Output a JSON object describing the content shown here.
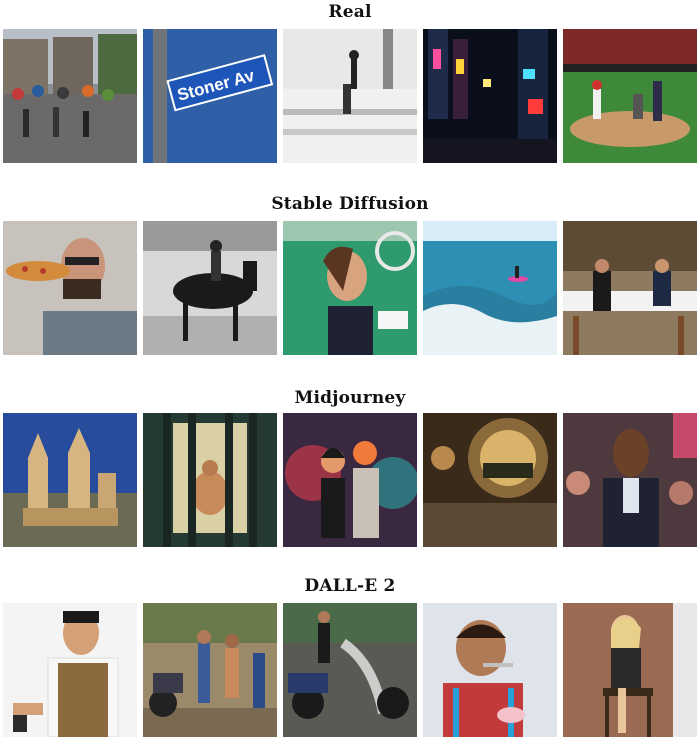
{
  "sections": [
    {
      "title": "Real",
      "images": [
        {
          "desc": "rainy city square with umbrellas"
        },
        {
          "desc": "blue street sign",
          "sign_text": "Stoner Av"
        },
        {
          "desc": "man on stage in black and white"
        },
        {
          "desc": "night city neon street"
        },
        {
          "desc": "baseball pitcher and batter"
        }
      ]
    },
    {
      "title": "Stable Diffusion",
      "images": [
        {
          "desc": "bearded man eating pizza"
        },
        {
          "desc": "rider on horse black and white"
        },
        {
          "desc": "woman with tennis racket"
        },
        {
          "desc": "surfer on ocean wave"
        },
        {
          "desc": "couple at restaurant tables"
        }
      ]
    },
    {
      "title": "Midjourney",
      "images": [
        {
          "desc": "fantasy castle towers"
        },
        {
          "desc": "figure behind bars"
        },
        {
          "desc": "stylized couple portrait"
        },
        {
          "desc": "view through a round window"
        },
        {
          "desc": "man in suit in crowd"
        }
      ]
    },
    {
      "title": "DALL-E 2",
      "images": [
        {
          "desc": "man in overalls with phone"
        },
        {
          "desc": "people washing motorcycle"
        },
        {
          "desc": "woman spraying motorcycle"
        },
        {
          "desc": "boy eating cupcake"
        },
        {
          "desc": "woman sitting on chair"
        }
      ]
    }
  ]
}
